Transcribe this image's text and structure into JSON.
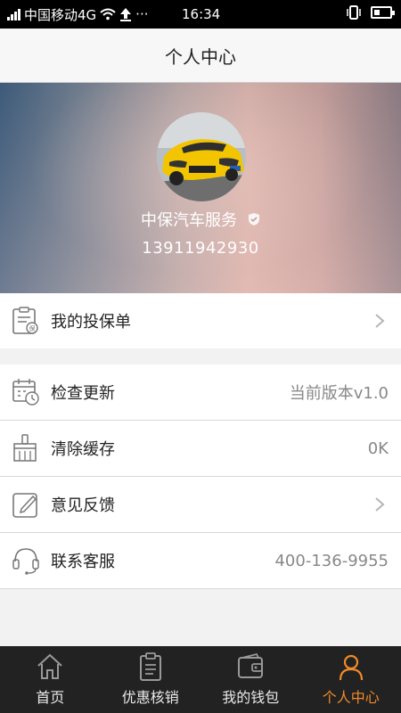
{
  "status_bar": {
    "carrier": "中国移动4G",
    "more": "···",
    "time": "16:34"
  },
  "header": {
    "title": "个人中心"
  },
  "profile": {
    "name": "中保汽车服务",
    "phone": "13911942930"
  },
  "menu_primary": [
    {
      "label": "我的投保单",
      "icon": "policy-document-icon"
    }
  ],
  "menu_secondary": [
    {
      "label": "检查更新",
      "value": "当前版本v1.0",
      "icon": "calendar-clock-icon"
    },
    {
      "label": "清除缓存",
      "value": "0K",
      "icon": "broom-icon"
    },
    {
      "label": "意见反馈",
      "icon": "edit-note-icon"
    },
    {
      "label": "联系客服",
      "value": "400-136-9955",
      "icon": "headset-icon"
    }
  ],
  "tabbar": {
    "tabs": [
      {
        "label": "首页",
        "icon": "home-icon"
      },
      {
        "label": "优惠核销",
        "icon": "clipboard-icon"
      },
      {
        "label": "我的钱包",
        "icon": "wallet-icon"
      },
      {
        "label": "个人中心",
        "icon": "person-icon",
        "active": true
      }
    ],
    "active_color": "#f08a2a"
  }
}
